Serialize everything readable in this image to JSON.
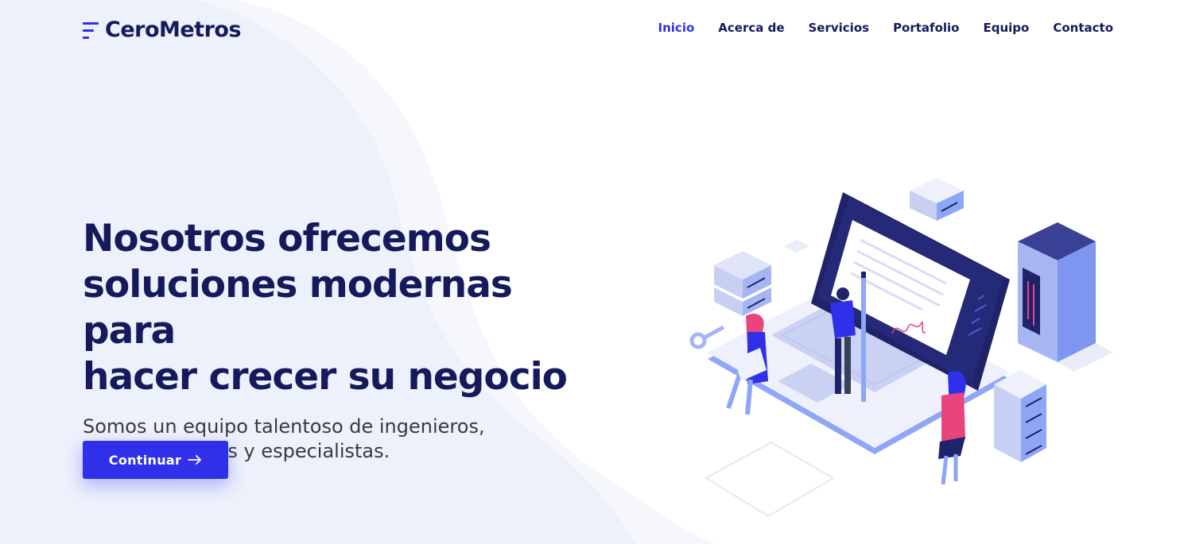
{
  "brand": {
    "name": "CeroMetros",
    "icon": "menu-lines-icon",
    "accent_color": "#3030ea",
    "text_color": "#141a5c"
  },
  "nav": {
    "items": [
      {
        "label": "Inicio",
        "active": true
      },
      {
        "label": "Acerca de",
        "active": false
      },
      {
        "label": "Servicios",
        "active": false
      },
      {
        "label": "Portafolio",
        "active": false
      },
      {
        "label": "Equipo",
        "active": false
      },
      {
        "label": "Contacto",
        "active": false
      }
    ]
  },
  "hero": {
    "title_line1": "Nosotros ofrecemos",
    "title_line2": "soluciones modernas para",
    "title_line3": "hacer crecer su negocio",
    "subtitle_line1": "Somos un equipo talentoso de ingenieros,",
    "subtitle_line2": "administradores y especialistas.",
    "cta_label": "Continuar",
    "cta_icon": "arrow-right-icon"
  },
  "illustration": {
    "name": "isometric-laptop-team-illustration"
  }
}
